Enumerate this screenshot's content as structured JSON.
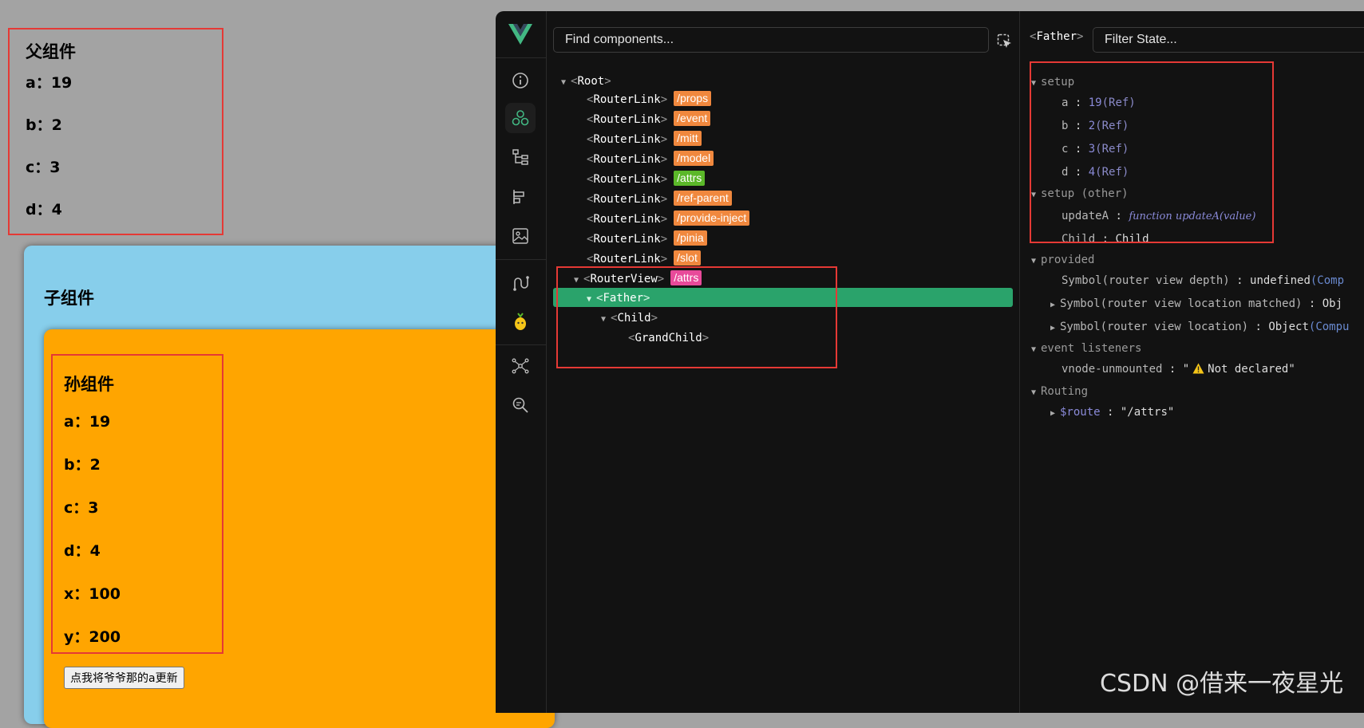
{
  "father": {
    "title": "父组件",
    "lines": [
      "a：19",
      "b：2",
      "c：3",
      "d：4"
    ]
  },
  "child": {
    "title": "子组件"
  },
  "grandchild": {
    "title": "孙组件",
    "lines": [
      "a：19",
      "b：2",
      "c：3",
      "d：4",
      "x：100",
      "y：200"
    ],
    "button_label": "点我将爷爷那的a更新"
  },
  "devtools": {
    "find_placeholder": "Find components...",
    "tree": {
      "root": "Root",
      "router_links": [
        {
          "label": "RouterLink",
          "path": "/props",
          "color": "#f0883e"
        },
        {
          "label": "RouterLink",
          "path": "/event",
          "color": "#f0883e"
        },
        {
          "label": "RouterLink",
          "path": "/mitt",
          "color": "#f0883e"
        },
        {
          "label": "RouterLink",
          "path": "/model",
          "color": "#f0883e"
        },
        {
          "label": "RouterLink",
          "path": "/attrs",
          "color": "#5bb829"
        },
        {
          "label": "RouterLink",
          "path": "/ref-parent",
          "color": "#f0883e"
        },
        {
          "label": "RouterLink",
          "path": "/provide-inject",
          "color": "#f0883e"
        },
        {
          "label": "RouterLink",
          "path": "/pinia",
          "color": "#f0883e"
        },
        {
          "label": "RouterLink",
          "path": "/slot",
          "color": "#f0883e"
        }
      ],
      "router_view": {
        "label": "RouterView",
        "path": "/attrs",
        "color": "#e84a9a"
      },
      "father": "Father",
      "child": "Child",
      "grandchild": "GrandChild"
    },
    "selected_component": "Father",
    "filter_placeholder": "Filter State...",
    "state": {
      "setup_label": "setup",
      "setup_items": [
        {
          "key": "a",
          "value": "19",
          "type": "(Ref)"
        },
        {
          "key": "b",
          "value": "2",
          "type": "(Ref)"
        },
        {
          "key": "c",
          "value": "3",
          "type": "(Ref)"
        },
        {
          "key": "d",
          "value": "4",
          "type": "(Ref)"
        }
      ],
      "setup_other_label": "setup (other)",
      "updateA_key": "updateA",
      "updateA_value": "function updateA(value)",
      "child_key": "Child",
      "child_value": "Child",
      "provided_label": "provided",
      "provided_items": [
        {
          "key": "Symbol(router view depth)",
          "value": "undefined",
          "hint": "(Comp"
        },
        {
          "key": "Symbol(router view location matched)",
          "value": "Obj",
          "hint": ""
        },
        {
          "key": "Symbol(router view location)",
          "value": "Object",
          "hint": "(Compu"
        }
      ],
      "events_label": "event listeners",
      "vnode_key": "vnode-unmounted",
      "vnode_value": "Not declared",
      "routing_label": "Routing",
      "route_key": "$route",
      "route_value": "\"/attrs\""
    }
  },
  "watermark": "CSDN @借来一夜星光"
}
